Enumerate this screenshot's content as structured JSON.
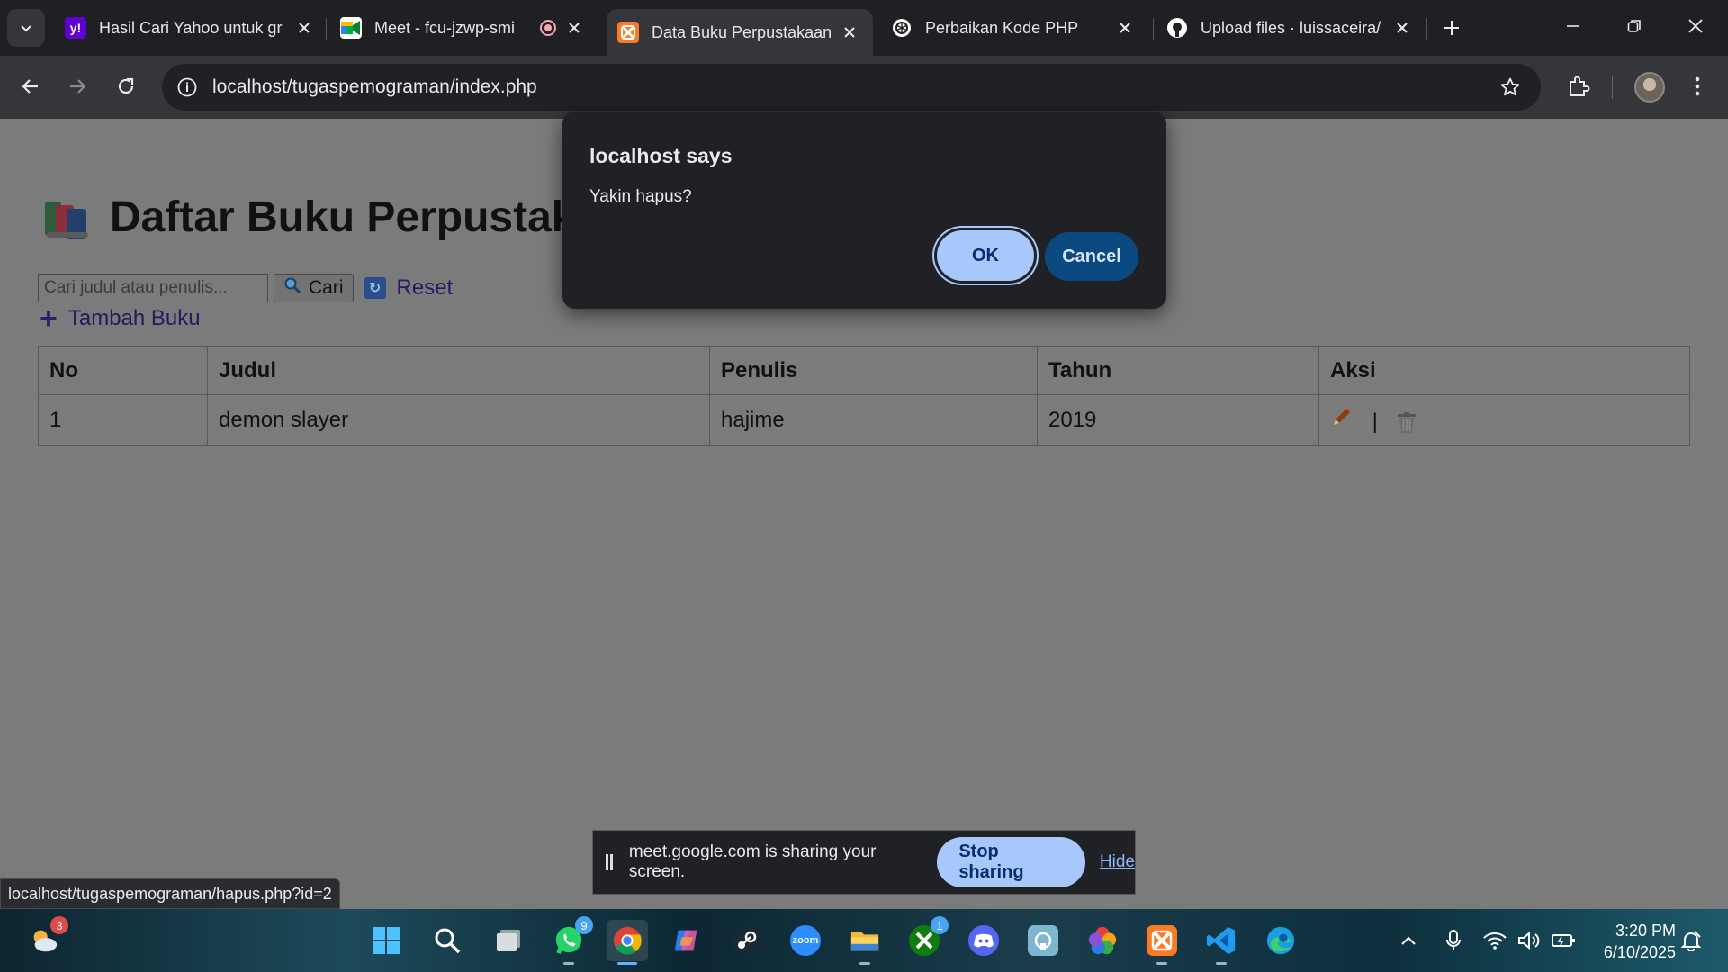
{
  "browser": {
    "tabs": [
      {
        "title": "Hasil Cari Yahoo untuk gr",
        "favicon": "yahoo-icon",
        "color": "#6001d2",
        "active": false
      },
      {
        "title": "Meet - fcu-jzwp-smi",
        "favicon": "google-meet-icon",
        "color": "#00897b",
        "active": false,
        "recording": true
      },
      {
        "title": "Data Buku Perpustakaan",
        "favicon": "xampp-icon",
        "color": "#fb7a24",
        "active": true
      },
      {
        "title": "Perbaikan Kode PHP",
        "favicon": "chatgpt-icon",
        "color": "#ffffff",
        "active": false
      },
      {
        "title": "Upload files · luissaceira/",
        "favicon": "github-icon",
        "color": "#ffffff",
        "active": false
      }
    ],
    "url": "localhost/tugaspemograman/index.php",
    "status_url": "localhost/tugaspemograman/hapus.php?id=2"
  },
  "page": {
    "title": "Daftar Buku Perpustak",
    "search_placeholder": "Cari judul atau penulis...",
    "search_button": "Cari",
    "reset_label": "Reset",
    "add_label": "Tambah Buku",
    "table": {
      "headers": [
        "No",
        "Judul",
        "Penulis",
        "Tahun",
        "Aksi"
      ],
      "rows": [
        {
          "no": "1",
          "judul": "demon slayer",
          "penulis": "hajime",
          "tahun": "2019",
          "separator": "|"
        }
      ]
    }
  },
  "dialog": {
    "title": "localhost says",
    "message": "Yakin hapus?",
    "ok": "OK",
    "cancel": "Cancel"
  },
  "share_bar": {
    "message": "meet.google.com is sharing your screen.",
    "stop": "Stop sharing",
    "hide": "Hide"
  },
  "taskbar": {
    "weather_badge": "3",
    "whatsapp_badge": "9",
    "xbox_badge": "1",
    "zoom_label": "zoom",
    "time": "3:20 PM",
    "date": "6/10/2025"
  }
}
